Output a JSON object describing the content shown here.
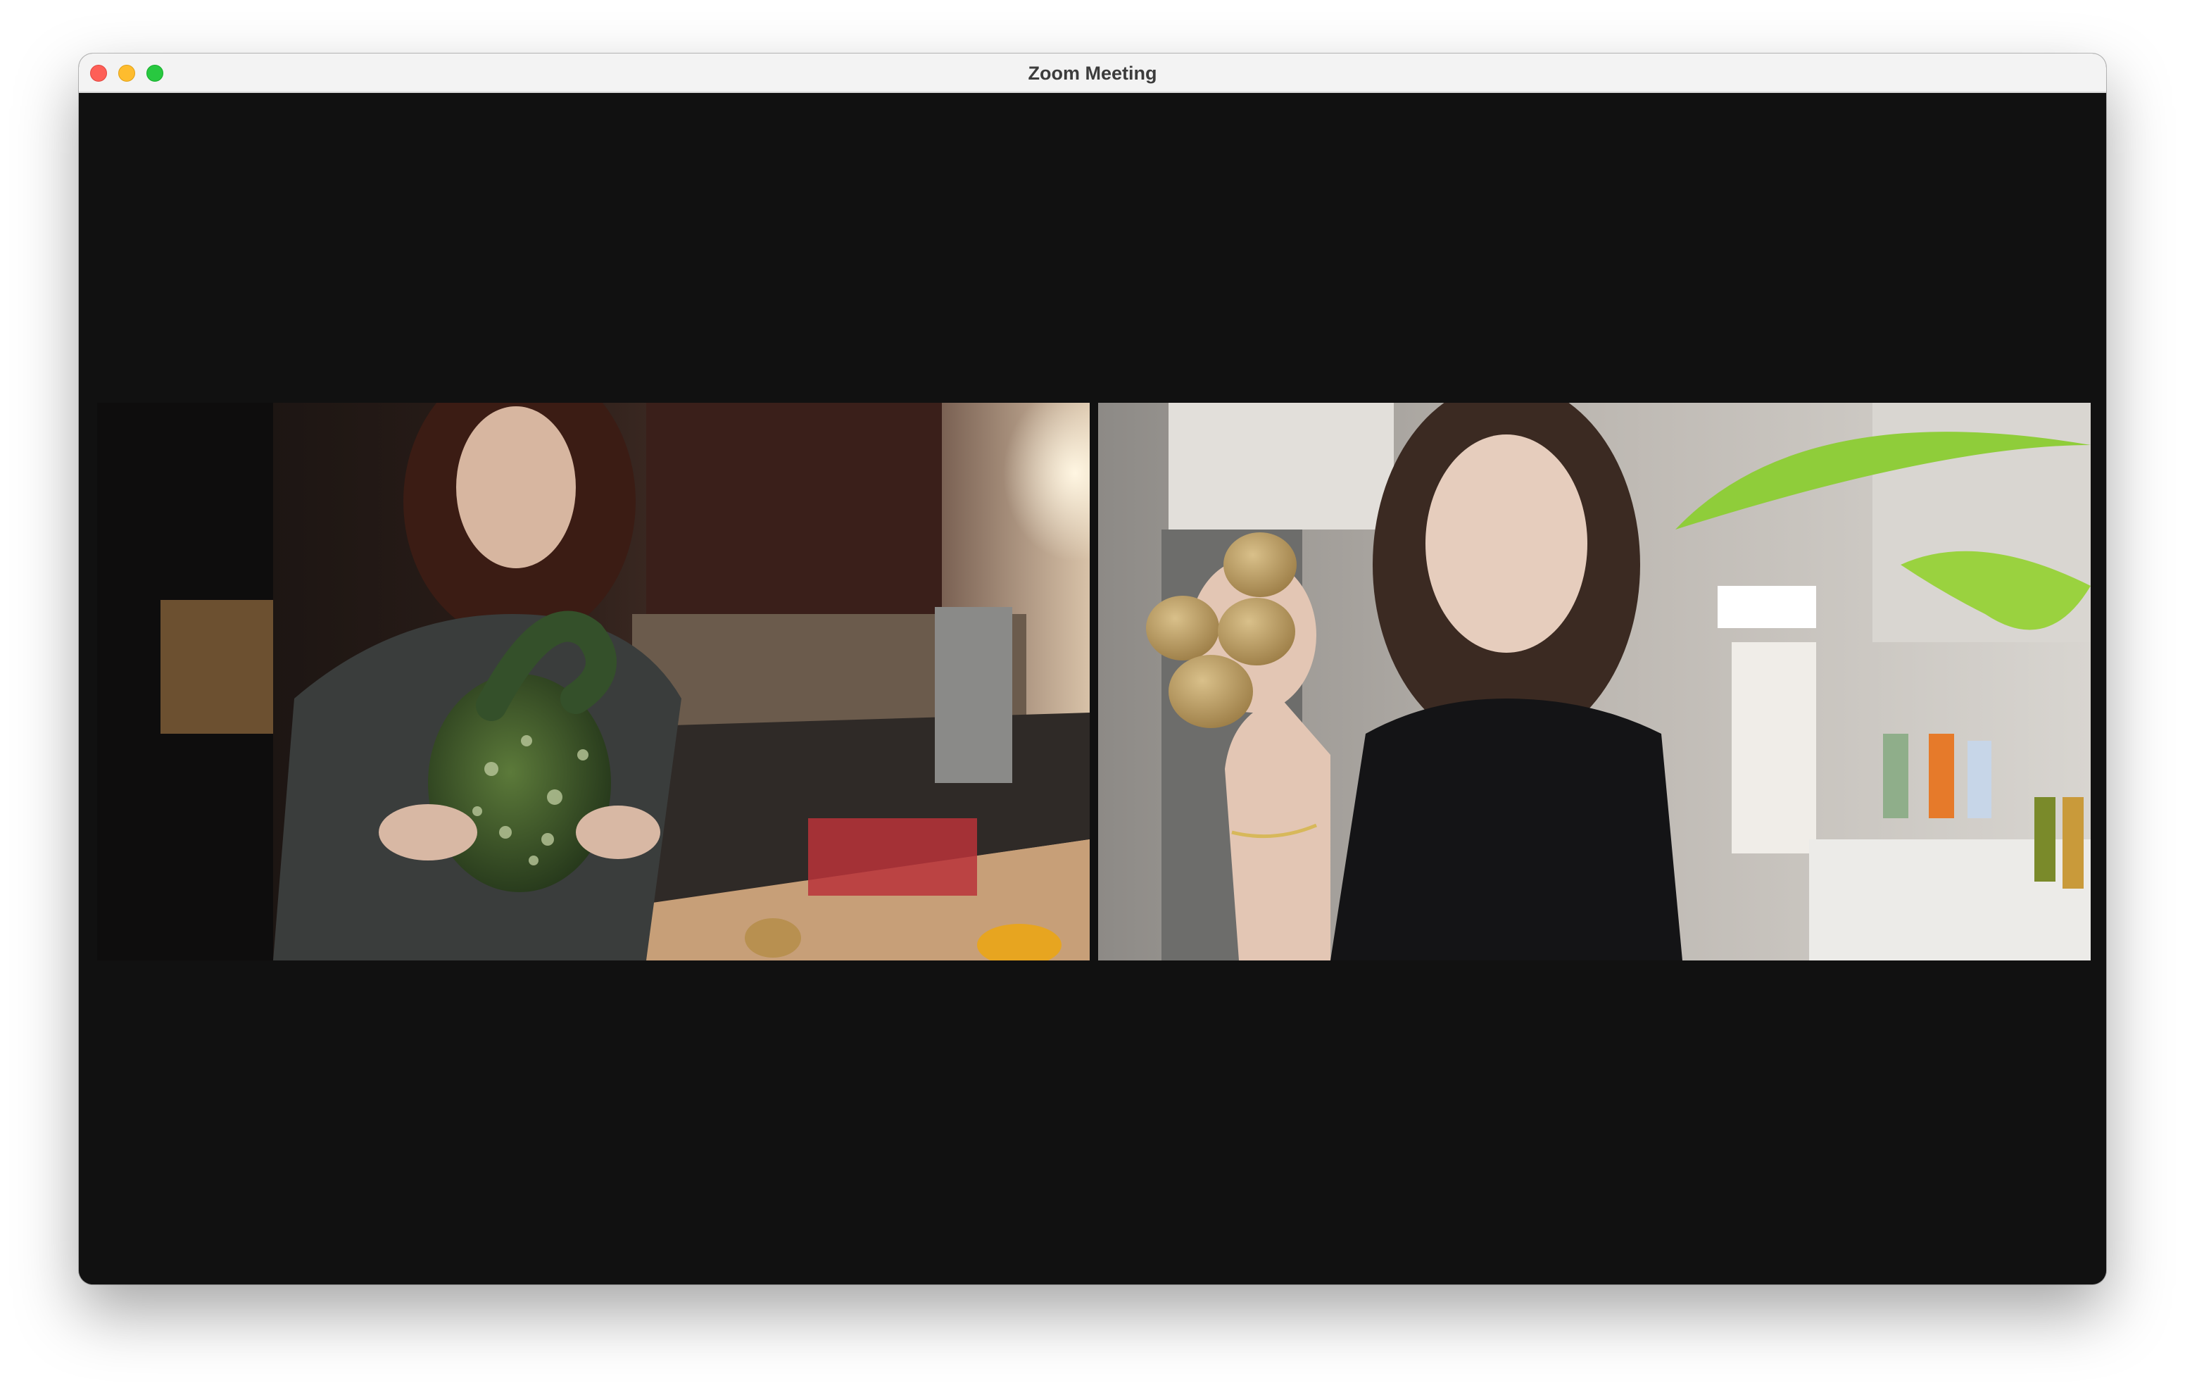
{
  "window": {
    "title": "Zoom Meeting",
    "controls": [
      "close-button",
      "minimize-button",
      "zoom-button"
    ],
    "colors": {
      "close": "#fe5f57",
      "minimize": "#febc2e",
      "zoom": "#28c840",
      "background": "#111111"
    }
  },
  "participants": [
    {
      "tile": "video-tile-1",
      "description_icon": "person-holding-gourd"
    },
    {
      "tile": "video-tile-2",
      "description_icon": "person-holding-potatoes"
    }
  ]
}
